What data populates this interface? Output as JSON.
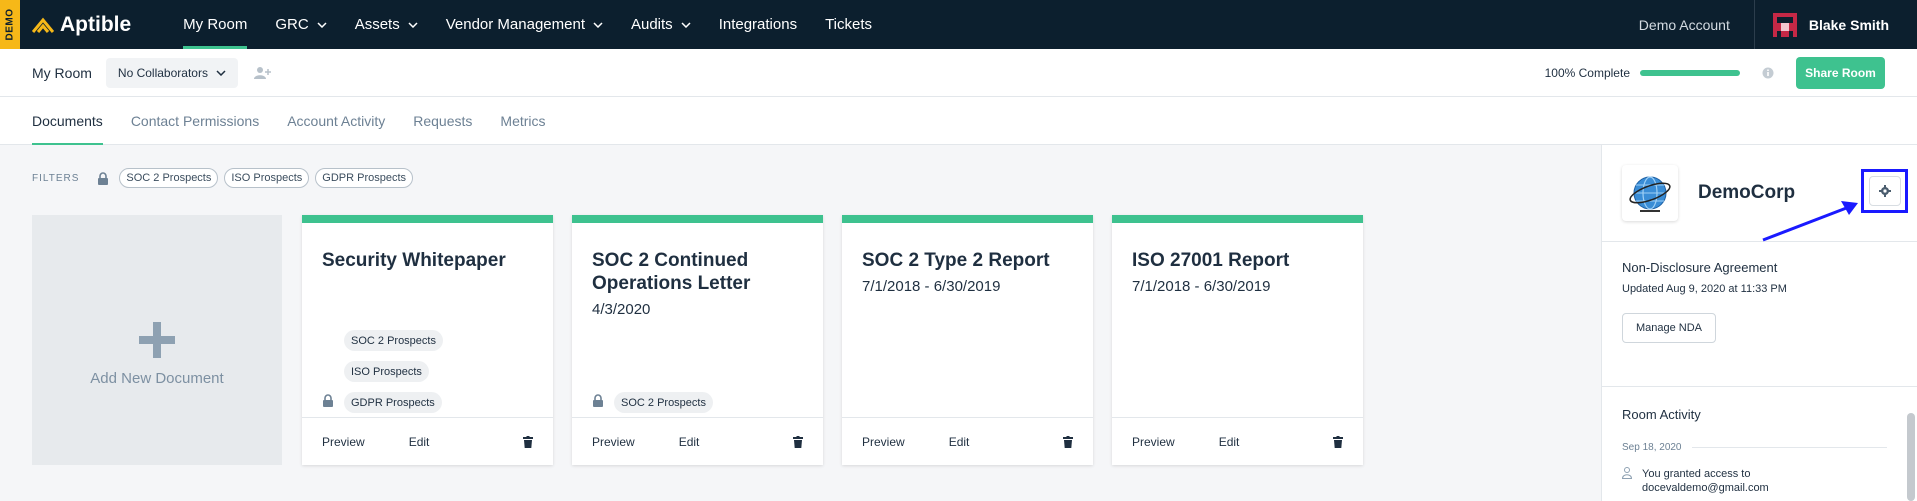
{
  "nav": {
    "demo_tag": "DEMO",
    "logo_text": "Aptible",
    "items": [
      {
        "label": "My Room",
        "dropdown": false,
        "active": true
      },
      {
        "label": "GRC",
        "dropdown": true,
        "active": false
      },
      {
        "label": "Assets",
        "dropdown": true,
        "active": false
      },
      {
        "label": "Vendor Management",
        "dropdown": true,
        "active": false
      },
      {
        "label": "Audits",
        "dropdown": true,
        "active": false
      },
      {
        "label": "Integrations",
        "dropdown": false,
        "active": false
      },
      {
        "label": "Tickets",
        "dropdown": false,
        "active": false
      }
    ],
    "demo_account": "Demo Account",
    "user_name": "Blake Smith"
  },
  "subheader": {
    "title": "My Room",
    "collaborators": "No Collaborators",
    "progress_label": "100% Complete",
    "progress_value": 100,
    "share_button": "Share Room"
  },
  "tabs": [
    {
      "label": "Documents",
      "active": true
    },
    {
      "label": "Contact Permissions",
      "active": false
    },
    {
      "label": "Account Activity",
      "active": false
    },
    {
      "label": "Requests",
      "active": false
    },
    {
      "label": "Metrics",
      "active": false
    }
  ],
  "filters": {
    "label": "FILTERS",
    "chips": [
      "SOC 2 Prospects",
      "ISO Prospects",
      "GDPR Prospects"
    ]
  },
  "add_document": {
    "label": "Add New Document"
  },
  "cards": [
    {
      "title": "Security Whitepaper",
      "date": "",
      "tags": [
        "SOC 2 Prospects",
        "ISO Prospects",
        "GDPR Prospects"
      ],
      "preview": "Preview",
      "edit": "Edit"
    },
    {
      "title": "SOC 2 Continued Operations Letter",
      "date": "4/3/2020",
      "tags": [
        "SOC 2 Prospects"
      ],
      "preview": "Preview",
      "edit": "Edit"
    },
    {
      "title": "SOC 2 Type 2 Report",
      "date": "7/1/2018 - 6/30/2019",
      "tags": [],
      "preview": "Preview",
      "edit": "Edit"
    },
    {
      "title": "ISO 27001 Report",
      "date": "7/1/2018 - 6/30/2019",
      "tags": [],
      "preview": "Preview",
      "edit": "Edit"
    }
  ],
  "right_panel": {
    "company_name": "DemoCorp",
    "nda_title": "Non-Disclosure Agreement",
    "nda_updated": "Updated Aug 9, 2020 at 11:33 PM",
    "nda_button": "Manage NDA",
    "activity_title": "Room Activity",
    "activity_date": "Sep 18, 2020",
    "activity_text_1": "You granted access to",
    "activity_text_2": "docevaldemo@gmail.com"
  },
  "colors": {
    "accent": "#3ec28f",
    "nav_bg": "#0c1f2e",
    "demo_tag": "#f6b818",
    "highlight": "#1a1aff"
  }
}
